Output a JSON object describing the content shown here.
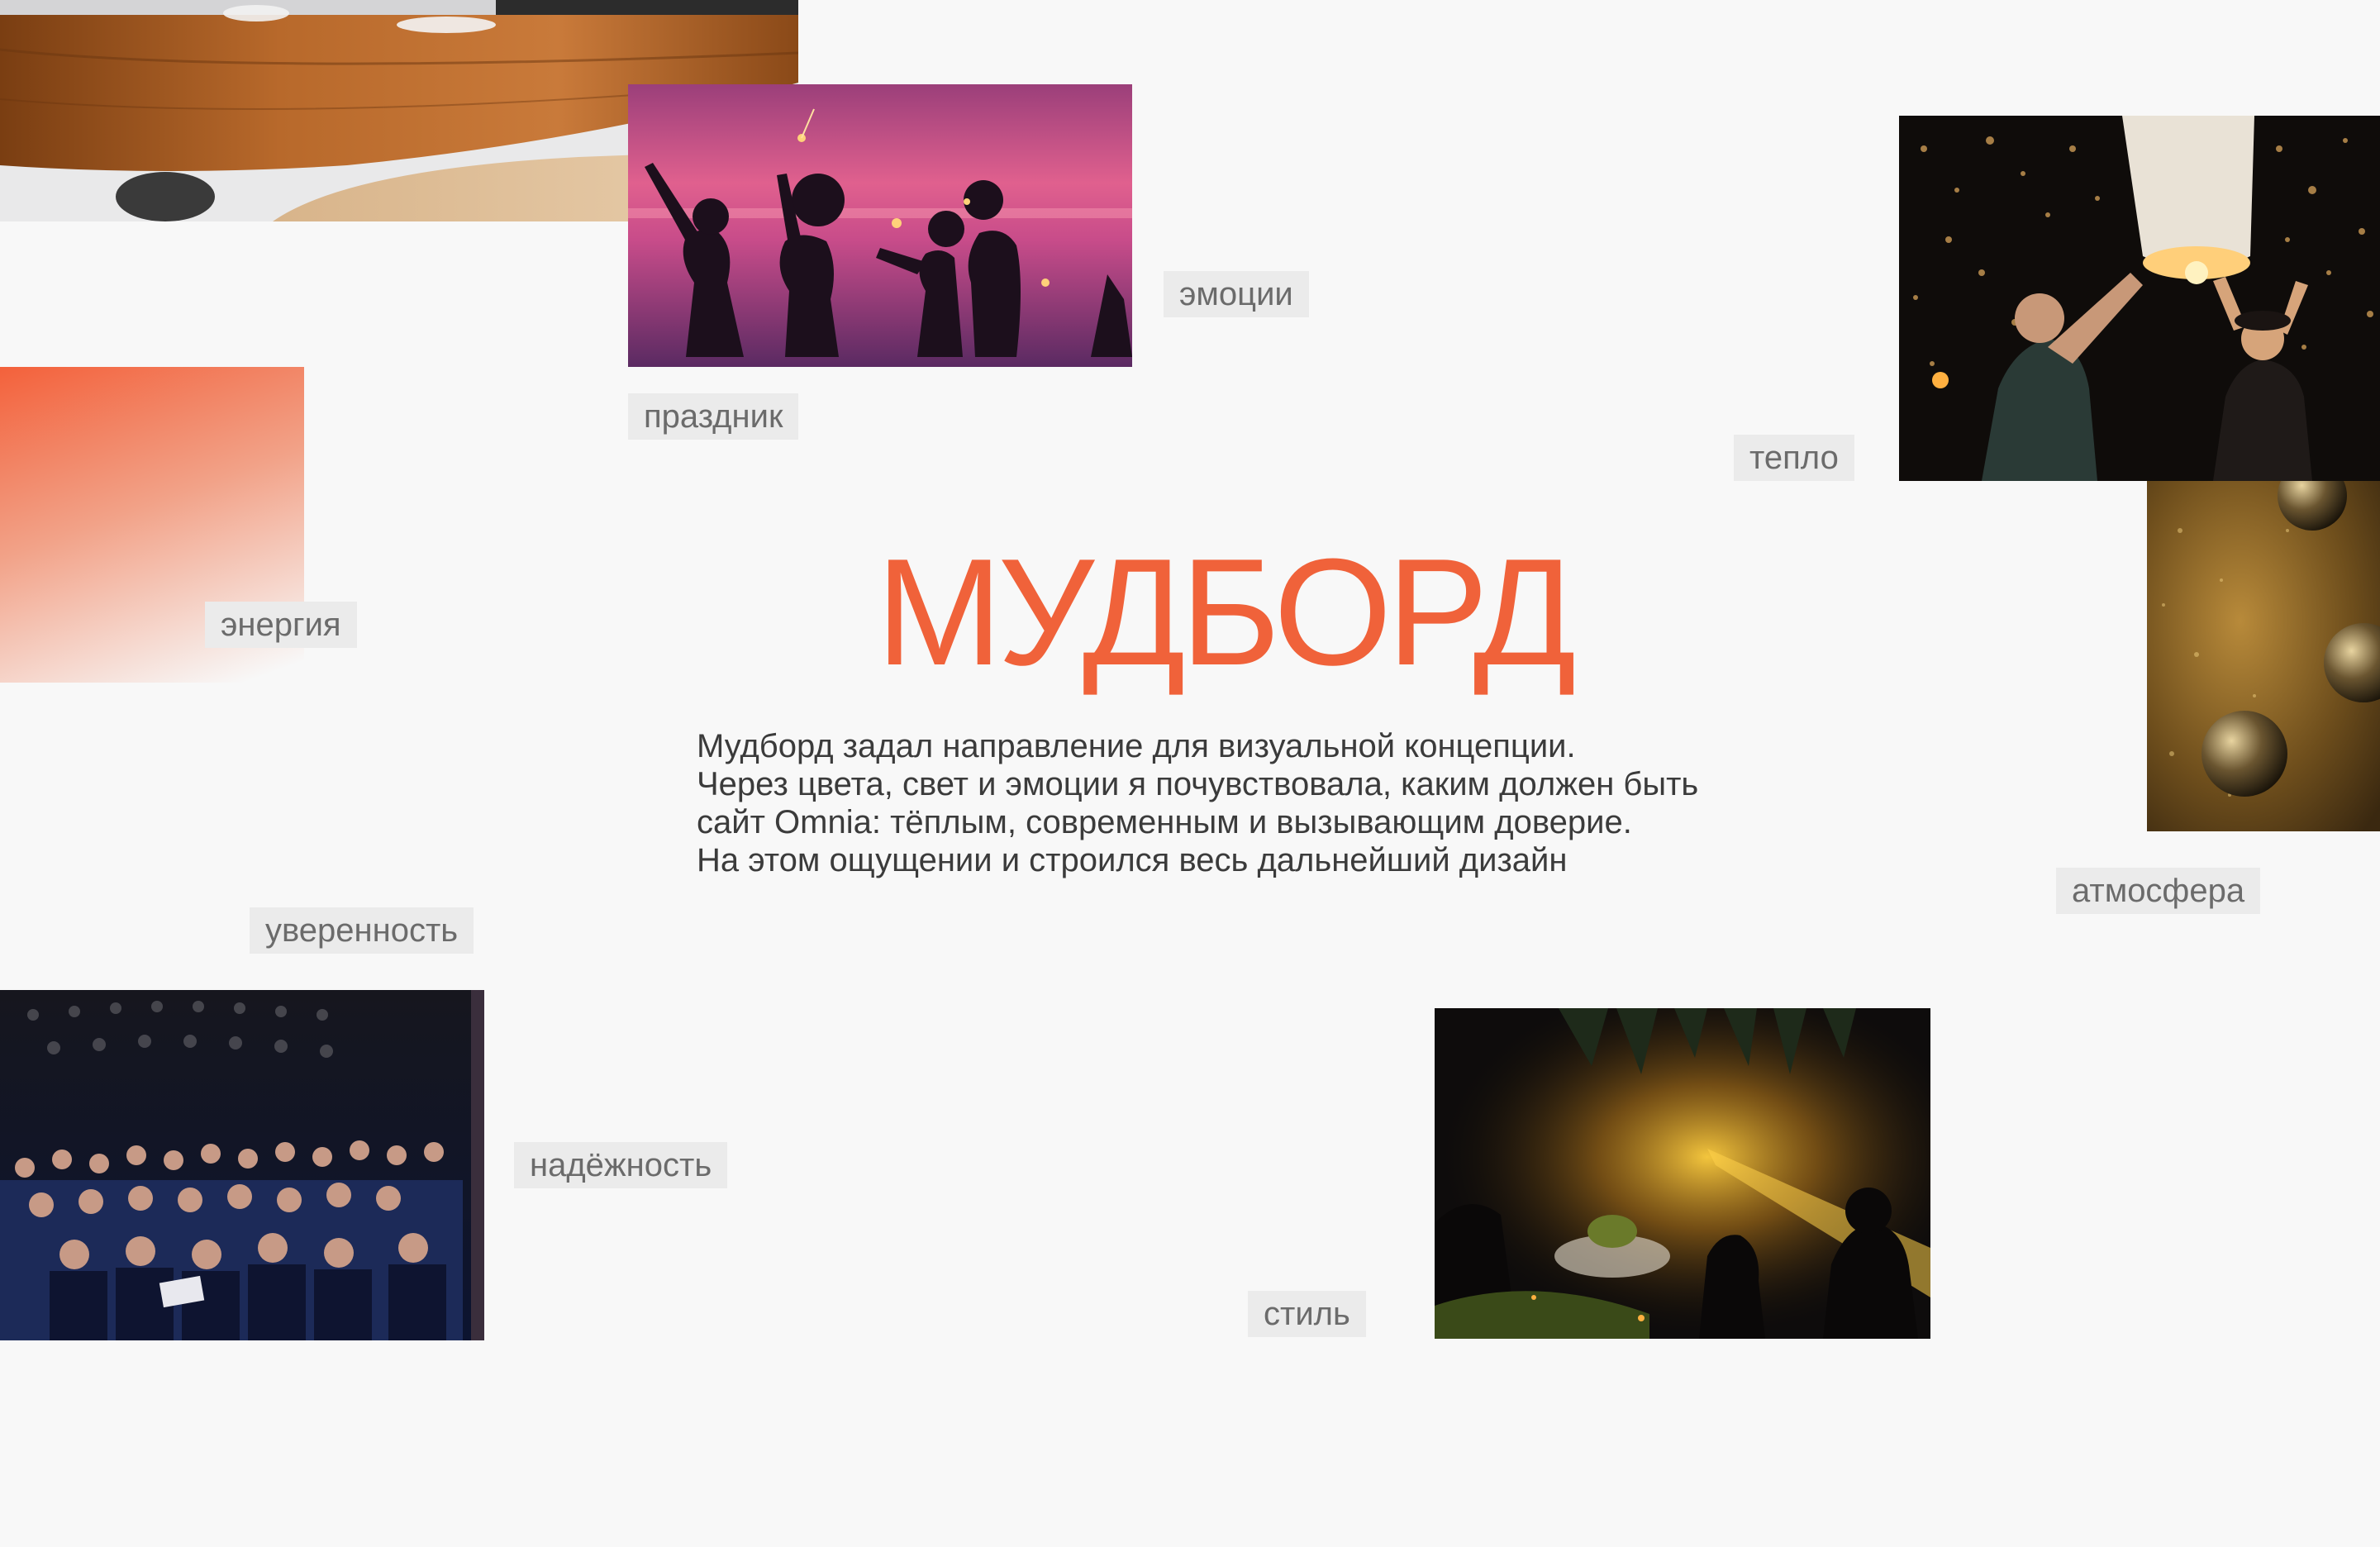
{
  "moodboard": {
    "title": "МУДБОРД",
    "description_lines": [
      "Мудборд задал направление для визуальной концепции.",
      "Через цвета, свет и эмоции я почувствовала, каким должен быть",
      "сайт Omnia: тёплым, современным и вызывающим доверие.",
      "На этом ощущении и строился весь дальнейший дизайн"
    ],
    "tags": {
      "emotions": "эмоции",
      "holiday": "праздник",
      "warmth": "тепло",
      "energy": "энергия",
      "atmosphere": "атмосфера",
      "confidence": "уверенность",
      "reliability": "надёжность",
      "style": "стиль"
    },
    "photos": {
      "restaurant_table": "wooden-table-photo",
      "sparklers_sunset": "sparklers-party-photo",
      "sky_lanterns": "sky-lanterns-photo",
      "gradient_swatch": "orange-gradient-swatch",
      "disco_balls": "disco-balls-photo",
      "conference_audience": "conference-audience-photo",
      "evening_event": "evening-event-photo"
    }
  },
  "colors": {
    "accent": "#f0623a",
    "background": "#f8f8f8",
    "tag_background": "#ebebeb",
    "tag_text": "#6b6b6b",
    "body_text": "#3b3b3b"
  }
}
